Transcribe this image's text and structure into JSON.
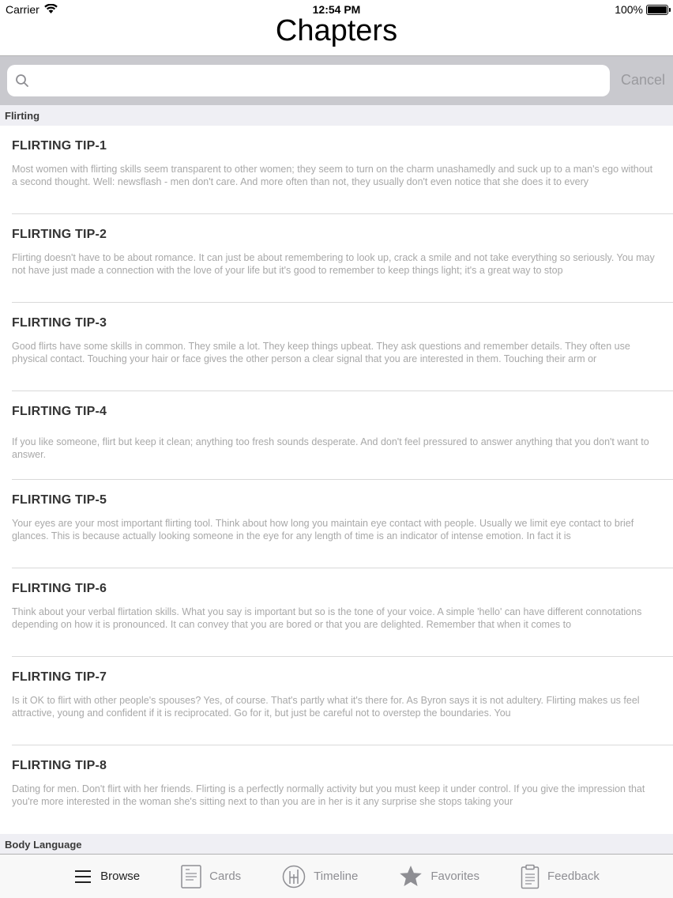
{
  "status_bar": {
    "carrier": "Carrier",
    "time": "12:54 PM",
    "battery": "100%"
  },
  "nav": {
    "title": "Chapters"
  },
  "search": {
    "placeholder": "",
    "value": "",
    "cancel_label": "Cancel"
  },
  "sections": [
    {
      "header": "Flirting",
      "items": [
        {
          "title": "FLIRTING TIP-1",
          "body": "Most women with flirting skills seem transparent to other women; they seem to turn on the charm unashamedly and suck up to a man's ego without a second thought. Well: newsflash - men don't care. And more often than not, they usually don't even notice that she does it to every"
        },
        {
          "title": "FLIRTING TIP-2",
          "body": "Flirting doesn't have to be about romance. It can just be about remembering to look up, crack a smile and not take everything so seriously. You may not have just made a connection with the love of your life but it's good to remember to keep things light; it's a great way to stop"
        },
        {
          "title": "FLIRTING TIP-3",
          "body": "Good flirts have some skills in common. They smile a lot. They keep things upbeat. They ask questions and remember details. They often use physical contact. Touching your hair or face gives the other person a clear signal that you are interested in them. Touching their arm or"
        },
        {
          "title": "FLIRTING TIP-4",
          "body": "If you like someone, flirt but keep it clean; anything too fresh sounds desperate. And don't feel pressured to answer anything that you don't want to answer."
        },
        {
          "title": "FLIRTING TIP-5",
          "body": "Your eyes are your most important flirting tool. Think about how long you maintain eye contact with people. Usually we limit eye contact to brief glances. This is because actually looking someone in the eye for any length of time is an indicator of intense emotion. In fact it is"
        },
        {
          "title": "FLIRTING TIP-6",
          "body": "Think about your verbal flirtation skills. What you say is important but so is the tone of your voice. A simple 'hello' can have different connotations depending on how it is pronounced. It can convey that you are bored or that you are delighted. Remember that when it comes to"
        },
        {
          "title": "FLIRTING TIP-7",
          "body": "Is it OK to flirt with other people's spouses? Yes, of course. That's partly what it's there for. As Byron says it is not adultery. Flirting makes us feel attractive, young and confident if it is reciprocated. Go for it, but just be careful not to overstep the boundaries. You"
        },
        {
          "title": "FLIRTING TIP-8",
          "body": "Dating for men. Don't flirt with her friends. Flirting is a perfectly normally activity but you must keep it under control. If you give the impression that you're more interested in the woman she's sitting next to than you are in her is it any surprise she stops taking your"
        }
      ]
    },
    {
      "header": "Body Language",
      "items": []
    }
  ],
  "tabs": [
    {
      "label": "Browse",
      "icon": "list-icon",
      "active": true
    },
    {
      "label": "Cards",
      "icon": "card-icon",
      "active": false
    },
    {
      "label": "Timeline",
      "icon": "timeline-icon",
      "active": false
    },
    {
      "label": "Favorites",
      "icon": "star-icon",
      "active": false
    },
    {
      "label": "Feedback",
      "icon": "clipboard-icon",
      "active": false
    }
  ],
  "colors": {
    "active_tab": "#222222",
    "inactive_tab": "#8e8e93",
    "body_text": "#a8a8a8",
    "search_bar_bg": "#c9c9ce"
  }
}
